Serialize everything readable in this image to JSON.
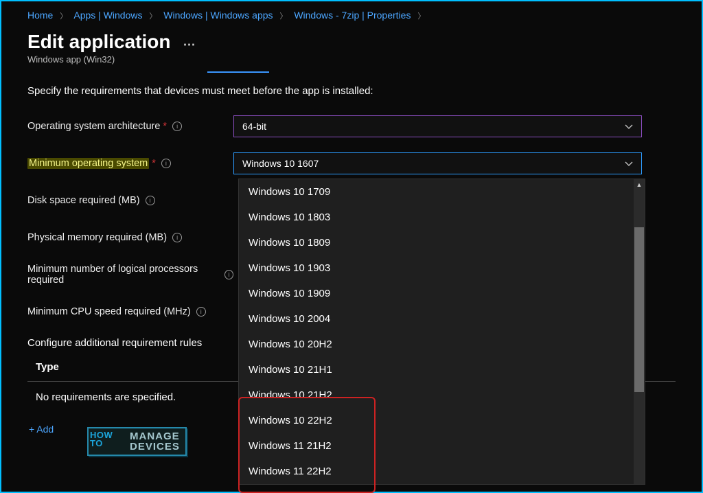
{
  "breadcrumb": {
    "items": [
      "Home",
      "Apps | Windows",
      "Windows | Windows apps",
      "Windows - 7zip | Properties"
    ]
  },
  "page": {
    "title": "Edit application",
    "subtitle": "Windows app (Win32)",
    "instruction": "Specify the requirements that devices must meet before the app is installed:"
  },
  "fields": {
    "os_arch": {
      "label": "Operating system architecture",
      "value": "64-bit",
      "required": true
    },
    "min_os": {
      "label": "Minimum operating system",
      "value": "Windows 10 1607",
      "required": true
    },
    "disk": {
      "label": "Disk space required (MB)"
    },
    "memory": {
      "label": "Physical memory required (MB)"
    },
    "processors": {
      "label": "Minimum number of logical processors required"
    },
    "cpu": {
      "label": "Minimum CPU speed required (MHz)"
    },
    "rules_header": "Configure additional requirement rules",
    "type_col": "Type",
    "no_req": "No requirements are specified.",
    "add": "+ Add"
  },
  "min_os_options": [
    "Windows 10 1709",
    "Windows 10 1803",
    "Windows 10 1809",
    "Windows 10 1903",
    "Windows 10 1909",
    "Windows 10 2004",
    "Windows 10 20H2",
    "Windows 10 21H1",
    "Windows 10 21H2",
    "Windows 10 22H2",
    "Windows 11 21H2",
    "Windows 11 22H2"
  ],
  "watermark": {
    "line1": "HOW",
    "line2": "TO",
    "brand1": "MANAGE",
    "brand2": "DEVICES"
  }
}
